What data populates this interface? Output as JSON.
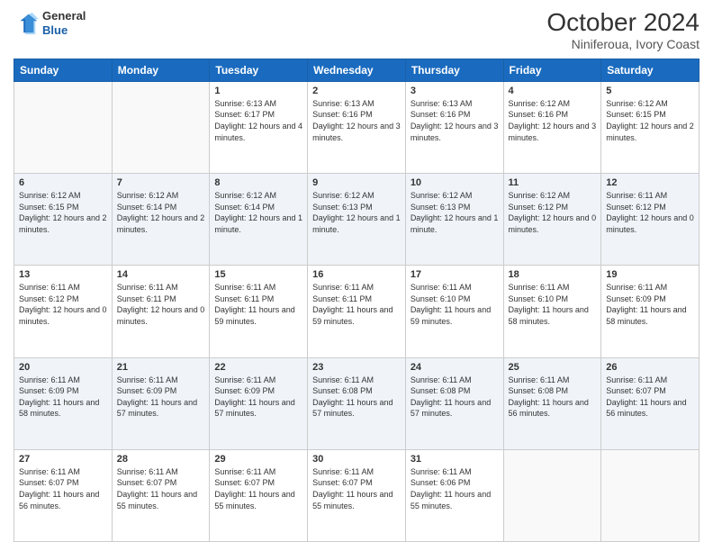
{
  "header": {
    "logo_line1": "General",
    "logo_line2": "Blue",
    "title": "October 2024",
    "subtitle": "Niniferoua, Ivory Coast"
  },
  "days_of_week": [
    "Sunday",
    "Monday",
    "Tuesday",
    "Wednesday",
    "Thursday",
    "Friday",
    "Saturday"
  ],
  "weeks": [
    [
      {
        "num": "",
        "info": ""
      },
      {
        "num": "",
        "info": ""
      },
      {
        "num": "1",
        "info": "Sunrise: 6:13 AM\nSunset: 6:17 PM\nDaylight: 12 hours and 4 minutes."
      },
      {
        "num": "2",
        "info": "Sunrise: 6:13 AM\nSunset: 6:16 PM\nDaylight: 12 hours and 3 minutes."
      },
      {
        "num": "3",
        "info": "Sunrise: 6:13 AM\nSunset: 6:16 PM\nDaylight: 12 hours and 3 minutes."
      },
      {
        "num": "4",
        "info": "Sunrise: 6:12 AM\nSunset: 6:16 PM\nDaylight: 12 hours and 3 minutes."
      },
      {
        "num": "5",
        "info": "Sunrise: 6:12 AM\nSunset: 6:15 PM\nDaylight: 12 hours and 2 minutes."
      }
    ],
    [
      {
        "num": "6",
        "info": "Sunrise: 6:12 AM\nSunset: 6:15 PM\nDaylight: 12 hours and 2 minutes."
      },
      {
        "num": "7",
        "info": "Sunrise: 6:12 AM\nSunset: 6:14 PM\nDaylight: 12 hours and 2 minutes."
      },
      {
        "num": "8",
        "info": "Sunrise: 6:12 AM\nSunset: 6:14 PM\nDaylight: 12 hours and 1 minute."
      },
      {
        "num": "9",
        "info": "Sunrise: 6:12 AM\nSunset: 6:13 PM\nDaylight: 12 hours and 1 minute."
      },
      {
        "num": "10",
        "info": "Sunrise: 6:12 AM\nSunset: 6:13 PM\nDaylight: 12 hours and 1 minute."
      },
      {
        "num": "11",
        "info": "Sunrise: 6:12 AM\nSunset: 6:12 PM\nDaylight: 12 hours and 0 minutes."
      },
      {
        "num": "12",
        "info": "Sunrise: 6:11 AM\nSunset: 6:12 PM\nDaylight: 12 hours and 0 minutes."
      }
    ],
    [
      {
        "num": "13",
        "info": "Sunrise: 6:11 AM\nSunset: 6:12 PM\nDaylight: 12 hours and 0 minutes."
      },
      {
        "num": "14",
        "info": "Sunrise: 6:11 AM\nSunset: 6:11 PM\nDaylight: 12 hours and 0 minutes."
      },
      {
        "num": "15",
        "info": "Sunrise: 6:11 AM\nSunset: 6:11 PM\nDaylight: 11 hours and 59 minutes."
      },
      {
        "num": "16",
        "info": "Sunrise: 6:11 AM\nSunset: 6:11 PM\nDaylight: 11 hours and 59 minutes."
      },
      {
        "num": "17",
        "info": "Sunrise: 6:11 AM\nSunset: 6:10 PM\nDaylight: 11 hours and 59 minutes."
      },
      {
        "num": "18",
        "info": "Sunrise: 6:11 AM\nSunset: 6:10 PM\nDaylight: 11 hours and 58 minutes."
      },
      {
        "num": "19",
        "info": "Sunrise: 6:11 AM\nSunset: 6:09 PM\nDaylight: 11 hours and 58 minutes."
      }
    ],
    [
      {
        "num": "20",
        "info": "Sunrise: 6:11 AM\nSunset: 6:09 PM\nDaylight: 11 hours and 58 minutes."
      },
      {
        "num": "21",
        "info": "Sunrise: 6:11 AM\nSunset: 6:09 PM\nDaylight: 11 hours and 57 minutes."
      },
      {
        "num": "22",
        "info": "Sunrise: 6:11 AM\nSunset: 6:09 PM\nDaylight: 11 hours and 57 minutes."
      },
      {
        "num": "23",
        "info": "Sunrise: 6:11 AM\nSunset: 6:08 PM\nDaylight: 11 hours and 57 minutes."
      },
      {
        "num": "24",
        "info": "Sunrise: 6:11 AM\nSunset: 6:08 PM\nDaylight: 11 hours and 57 minutes."
      },
      {
        "num": "25",
        "info": "Sunrise: 6:11 AM\nSunset: 6:08 PM\nDaylight: 11 hours and 56 minutes."
      },
      {
        "num": "26",
        "info": "Sunrise: 6:11 AM\nSunset: 6:07 PM\nDaylight: 11 hours and 56 minutes."
      }
    ],
    [
      {
        "num": "27",
        "info": "Sunrise: 6:11 AM\nSunset: 6:07 PM\nDaylight: 11 hours and 56 minutes."
      },
      {
        "num": "28",
        "info": "Sunrise: 6:11 AM\nSunset: 6:07 PM\nDaylight: 11 hours and 55 minutes."
      },
      {
        "num": "29",
        "info": "Sunrise: 6:11 AM\nSunset: 6:07 PM\nDaylight: 11 hours and 55 minutes."
      },
      {
        "num": "30",
        "info": "Sunrise: 6:11 AM\nSunset: 6:07 PM\nDaylight: 11 hours and 55 minutes."
      },
      {
        "num": "31",
        "info": "Sunrise: 6:11 AM\nSunset: 6:06 PM\nDaylight: 11 hours and 55 minutes."
      },
      {
        "num": "",
        "info": ""
      },
      {
        "num": "",
        "info": ""
      }
    ]
  ]
}
